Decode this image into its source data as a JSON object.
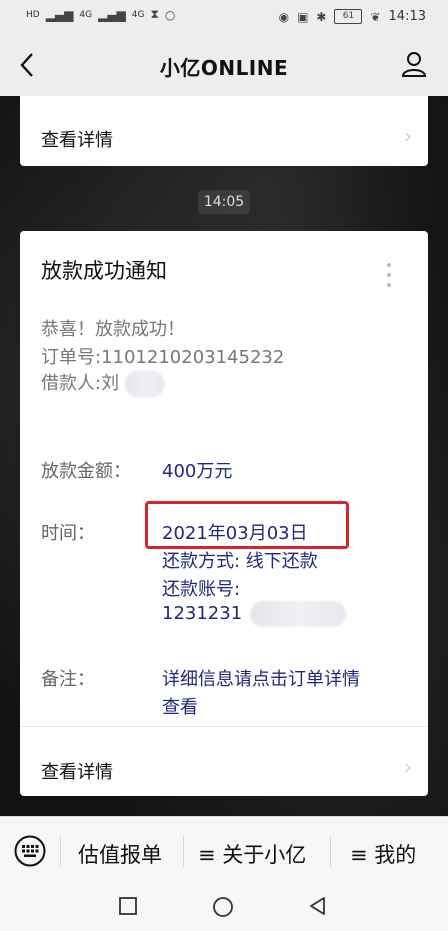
{
  "status_bar": {
    "left_labels": [
      "HD",
      "4G",
      "4G"
    ],
    "battery": "61",
    "time": "14:13"
  },
  "header": {
    "title": "小亿ONLINE"
  },
  "top_card": {
    "view_details": "查看详情"
  },
  "timestamp": "14:05",
  "message": {
    "title": "放款成功通知",
    "congrats": "恭喜！放款成功！",
    "order_label": "订单号:",
    "order_number": "1101210203145232",
    "borrower_label": "借款人:",
    "borrower_name": "刘",
    "amount_label": "放款金额：",
    "amount_value": "400万元",
    "time_label": "时间：",
    "time_value": "2021年03月03日",
    "repay_method": "还款方式: 线下还款",
    "repay_account_label": "还款账号:",
    "repay_account": "1231231",
    "remark_label": "备注：",
    "remark_line1": "详细信息请点击订单详情",
    "remark_line2": "查看",
    "view_details": "查看详情",
    "highlight_color": "#d8262c",
    "value_color": "#1f2a7a"
  },
  "bottom_menu": {
    "items": [
      "估值报单",
      "≡ 关于小亿",
      "≡ 我的"
    ]
  }
}
